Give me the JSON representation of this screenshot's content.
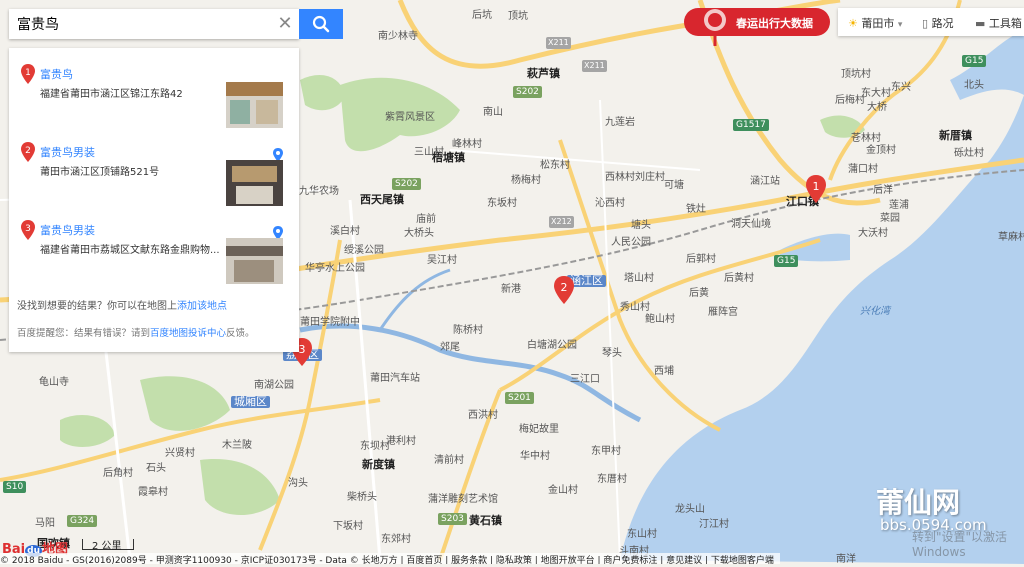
{
  "search": {
    "value": "富贵鸟",
    "clear_icon": "close-icon",
    "button_icon": "search-icon"
  },
  "results": [
    {
      "index": "1",
      "name": "富贵鸟",
      "address": "福建省莆田市涵江区锦江东路42"
    },
    {
      "index": "2",
      "name": "富贵鸟男装",
      "address": "莆田市涵江区顶铺路521号"
    },
    {
      "index": "3",
      "name": "富贵鸟男装",
      "address": "福建省莆田市荔城区文献东路金鼎购物..."
    }
  ],
  "notfound": {
    "text": "没找到想要的结果？你可以在地图上",
    "link": "添加该地点"
  },
  "tip": {
    "text": "百度提醒您：结果有错误？请到",
    "link": "百度地图投诉中心",
    "suffix": "反馈。"
  },
  "banner": {
    "text": "春运出行大数据"
  },
  "toolbar": {
    "city": "莆田市",
    "traffic": "路况",
    "tools": "工具箱"
  },
  "scale": {
    "label": "2 公里"
  },
  "logo": {
    "text_bai": "Bai",
    "text_du": "du",
    "text_map": "地图"
  },
  "copyright": "© 2018 Baidu - GS(2016)2089号 - 甲测资字1100930 - 京ICP证030173号 - Data © 长地万方 | 百度首页 | 服务条款 | 隐私政策 | 地图开放平台 | 商户免费标注 | 意见建议 | 下载地图客户端",
  "watermark": {
    "title": "莆仙网",
    "url": "bbs.0594.com"
  },
  "win_activation": "转到\"设置\"以激活 Windows",
  "map_markers": [
    "1",
    "2",
    "3"
  ],
  "labels": {
    "towns": [
      "梧塘镇",
      "萩芦镇",
      "江口镇",
      "西天尾镇",
      "新度镇",
      "黄石镇",
      "涵江区",
      "荔城区",
      "城厢区",
      "国欢镇"
    ],
    "places": [
      "南少林寺",
      "紫霄风景区",
      "九华农场",
      "溪白村",
      "绶溪公园",
      "华亭水上公园",
      "莆田学院附中",
      "南湖公园",
      "龟山寺",
      "木兰陂",
      "兴贤村",
      "后角村",
      "霞皋村",
      "石头",
      "马阳",
      "沟头",
      "莆田汽车站",
      "陈桥村",
      "郊尾",
      "东坝村",
      "港利村",
      "清前村",
      "柴桥头",
      "下坂村",
      "东郊村",
      "华中村",
      "新港",
      "人民公园",
      "白塘湖公园",
      "三江口",
      "梅妃故里",
      "蒲洋雕刻艺术馆",
      "西洪村",
      "东甲村",
      "金山村",
      "东厝村",
      "东山村",
      "汀江村",
      "斗南村",
      "龙头山",
      "南洋",
      "沁西村",
      "西林村",
      "刘庄村",
      "可塘",
      "塘头",
      "铁灶",
      "涵江站",
      "洞天仙境",
      "后郭村",
      "塔山村",
      "后黄",
      "秀山村",
      "鲍山村",
      "雁阵宫",
      "琴头",
      "西埔",
      "后黄村",
      "东坂村",
      "杨梅村",
      "松东村",
      "三山村",
      "庙前",
      "大桥头",
      "吴江村",
      "峰林村",
      "南山",
      "九莲岩",
      "后坑",
      "顶坑",
      "顶坑村",
      "东大村",
      "大桥",
      "苍林村",
      "金顶村",
      "后梅村",
      "蒲口村",
      "新厝镇",
      "砾灶村",
      "莲浦",
      "后洋",
      "大沃村",
      "菜园",
      "草麻村",
      "北头",
      "东兴"
    ],
    "water": [
      "兴化湾"
    ],
    "roads": [
      "S202",
      "S203",
      "S201",
      "G324",
      "S10",
      "G15",
      "G1517",
      "X211",
      "X212"
    ]
  }
}
